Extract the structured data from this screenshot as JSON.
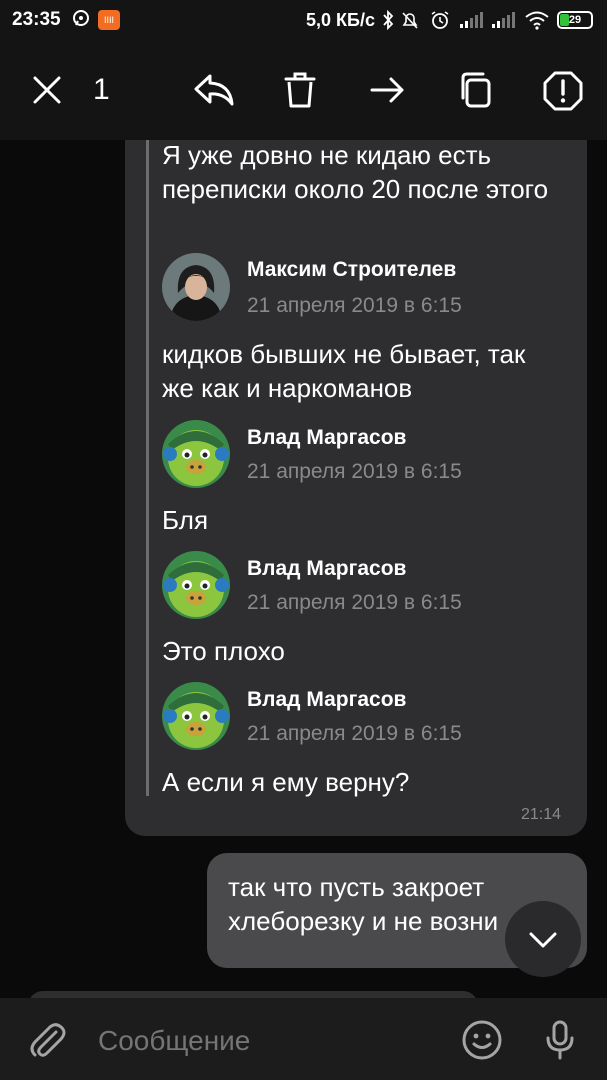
{
  "status_bar": {
    "time": "23:35",
    "network_speed": "5,0 КБ/с",
    "battery_level": "29",
    "app_icon_text": "IIII"
  },
  "toolbar": {
    "selected_count": "1"
  },
  "forwarded": {
    "intro_text": "Я уже довно не кидаю есть переписки около 20 после этого",
    "messages": [
      {
        "author": "Максим Строителев",
        "date": "21 апреля 2019 в 6:15",
        "text": "кидков бывших не бывает, так же как и наркоманов"
      },
      {
        "author": "Влад Маргасов",
        "date": "21 апреля 2019 в 6:15",
        "text": "Бля"
      },
      {
        "author": "Влад Маргасов",
        "date": "21 апреля 2019 в 6:15",
        "text": "Это плохо"
      },
      {
        "author": "Влад Маргасов",
        "date": "21 апреля 2019 в 6:15",
        "text": "А если я ему верну?"
      }
    ]
  },
  "incoming_time": "21:14",
  "outgoing": {
    "text": "так что пусть закроет хлеборезку и не возни"
  },
  "composer": {
    "placeholder": "Сообщение"
  },
  "colors": {
    "background": "#0a0a0a",
    "bubble_in": "#2e2e30",
    "bubble_out": "#4a4a4c",
    "muted_text": "#8a8a8c",
    "battery_green": "#33c23a",
    "app_orange": "#f26d21"
  }
}
